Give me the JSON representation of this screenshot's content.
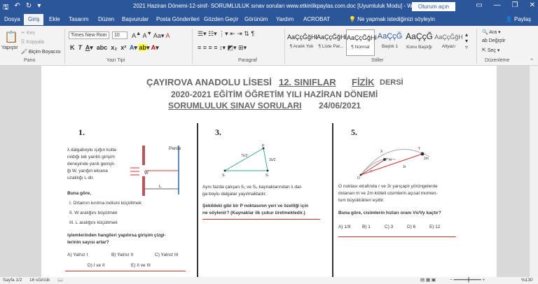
{
  "window": {
    "title": "2021 Haziran Dönemi-12-sinif- SORUMLULUK sınav soruları www.etkinlikpaylas.com.doc [Uyumluluk Modu] - Word",
    "sign_in": "Oturum açın"
  },
  "tabs": [
    "Dosya",
    "Giriş",
    "Ekle",
    "Tasarım",
    "Düzen",
    "Başvurular",
    "Posta Gönderileri",
    "Gözden Geçir",
    "Görünüm",
    "Yardım",
    "ACROBAT"
  ],
  "tell_me": "Ne yapmak istediğinizi söyleyin",
  "share": "Paylaş",
  "ribbon": {
    "clipboard": {
      "paste": "Yapıştır",
      "cut": "Kes",
      "copy": "Kopyala",
      "format_painter": "Biçim Boyacısı",
      "label": "Pano"
    },
    "font": {
      "name": "Times New Rom",
      "size": "10",
      "label": "Yazı Tipi"
    },
    "paragraph": {
      "label": "Paragraf"
    },
    "styles": {
      "label": "Stiller",
      "items": [
        {
          "sample": "AaÇçĞğHł",
          "name": "¶ Aralık Yok"
        },
        {
          "sample": "AaÇçĞğHł",
          "name": "¶ Liste Par..."
        },
        {
          "sample": "AaÇçĞğHł",
          "name": "¶ Normal"
        },
        {
          "sample": "AaÇçĞ",
          "name": "Başlık 1"
        },
        {
          "sample": "AaÇçĞ",
          "name": "Konu Başlığı"
        },
        {
          "sample": "AaÇçĞğH",
          "name": "Altyazı"
        }
      ]
    },
    "editing": {
      "find": "Ara",
      "replace": "Değiştir",
      "select": "Seç",
      "label": "Düzenleme"
    }
  },
  "document": {
    "school": "ÇAYIROVA ANADOLU LİSESİ",
    "grade": "12. SINIFLAR",
    "subject": "FİZİK",
    "lesson": "DERSİ",
    "period": "2020-2021 EĞİTİM ÖĞRETİM YILI HAZİRAN DÖNEMİ",
    "exam": "SORUMLULUK  SINAV SORULARI",
    "date": "24/06/2021",
    "q1": {
      "num": "1.",
      "label_screen": "Perde",
      "lines": [
        "λ dalgaboylu ışığın kulla-",
        "nıldığı tek yarıklı girişim",
        "deneyinde yarık genişli-",
        "ği W, yarığın ekrana",
        "uzaklığı L dir."
      ],
      "prompt": "Buna göre,",
      "options": [
        "I.   Ortamın kırılma indisini küçültmek",
        "II.  W aralığını büyütmek",
        "III. L aralığını küçültmek"
      ],
      "question": [
        "işlemlerinden hangileri yapılırsa girişim çizgi-",
        "lerinin sayısı artar?"
      ],
      "answers": [
        "A) Yalnız I",
        "B) Yalnız II",
        "C) Yalnız III",
        "D) I ve II",
        "E) II ve III"
      ]
    },
    "q3": {
      "num": "3.",
      "lines": [
        "Aynı fazda çalışan S₁ ve S₂ kaynaklarından λ dal-",
        "ga boylu dalgalar yayılmaktadır."
      ],
      "question": [
        "Şekildeki gibi bir P noktasının yeri ve özelliği için",
        "ne söylenir? (Kaynaklar ilk çukur üretmektedir.)"
      ]
    },
    "q5": {
      "num": "5.",
      "lines": [
        "O noktası etrafında r ve 3r yarıçaplı yörüngelerde",
        "dolanan m ve 2m kütleli cisimlerin açısal momen-",
        "tum büyüklükleri eşittir."
      ],
      "question": "Buna göre, cisimlerin hızları oranı",
      "ratio": "Vx/Vy",
      "ask": "kaçtır?",
      "answers": [
        "A) 1/9",
        "B) 1",
        "C) 3",
        "D) 6",
        "E) 12"
      ]
    }
  },
  "status": {
    "page": "Sayfa 1/2",
    "words": "16 sözcük",
    "zoom": "%130"
  }
}
